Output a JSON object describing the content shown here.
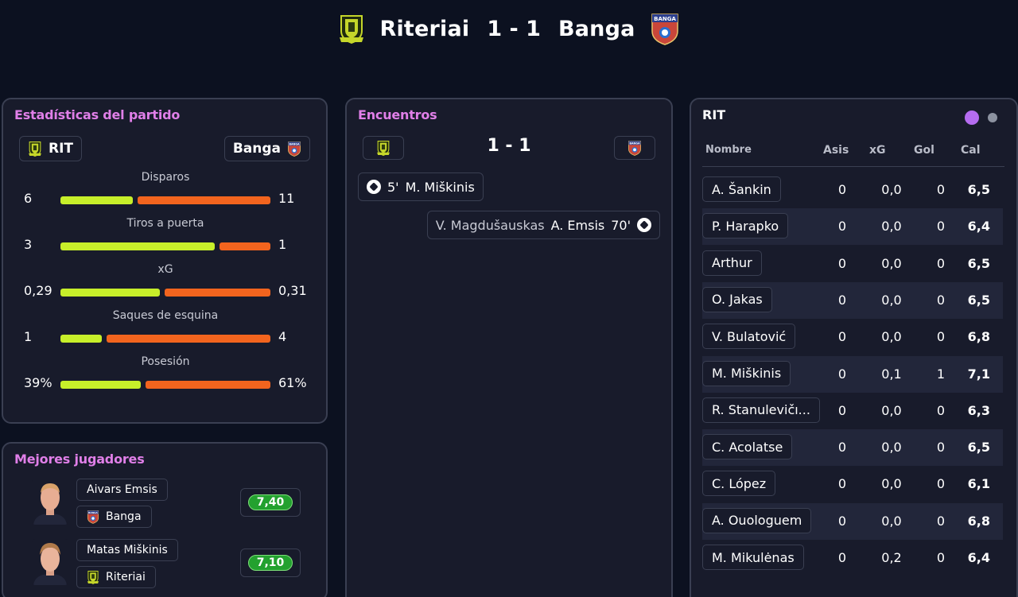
{
  "header": {
    "home_team": "Riteriai",
    "score": "1 - 1",
    "away_team": "Banga",
    "home_crest": "riteriai-crest-icon",
    "away_crest": "banga-crest-icon"
  },
  "stats": {
    "title": "Estadísticas del partido",
    "home_chip": "RIT",
    "away_chip": "Banga",
    "rows": [
      {
        "label": "Disparos",
        "home": "6",
        "away": "11",
        "home_share": 0.353
      },
      {
        "label": "Tiros a puerta",
        "home": "3",
        "away": "1",
        "home_share": 0.75
      },
      {
        "label": "xG",
        "home": "0,29",
        "away": "0,31",
        "home_share": 0.483
      },
      {
        "label": "Saques de esquina",
        "home": "1",
        "away": "4",
        "home_share": 0.2
      },
      {
        "label": "Posesión",
        "home": "39%",
        "away": "61%",
        "home_share": 0.39
      }
    ],
    "colors": {
      "home": "#c7ef2a",
      "away": "#f2641e"
    }
  },
  "best_players": {
    "title": "Mejores jugadores",
    "players": [
      {
        "name": "Aivars Emsis",
        "team": "Banga",
        "rating": "7,40"
      },
      {
        "name": "Matas Miškinis",
        "team": "Riteriai",
        "rating": "7,10"
      }
    ]
  },
  "encounters": {
    "title": "Encuentros",
    "score": "1 - 1",
    "events": [
      {
        "minute": "5'",
        "player": "M. Miškinis",
        "side": "home"
      },
      {
        "assist": "V. Magdušauskas",
        "player": "A. Emsis",
        "minute": "70'",
        "side": "away"
      }
    ]
  },
  "lineup": {
    "title": "RIT",
    "toggle_colors": [
      "#b56cf0",
      "#8c92a0"
    ],
    "columns": [
      "Nombre",
      "Asis",
      "xG",
      "Gol",
      "Cal"
    ],
    "rows": [
      {
        "name": "A. Šankin",
        "asis": "0",
        "xg": "0,0",
        "gol": "0",
        "cal": "6,5"
      },
      {
        "name": "P. Harapko",
        "asis": "0",
        "xg": "0,0",
        "gol": "0",
        "cal": "6,4"
      },
      {
        "name": "Arthur",
        "asis": "0",
        "xg": "0,0",
        "gol": "0",
        "cal": "6,5"
      },
      {
        "name": "O. Jakas",
        "asis": "0",
        "xg": "0,0",
        "gol": "0",
        "cal": "6,5"
      },
      {
        "name": "V. Bulatović",
        "asis": "0",
        "xg": "0,0",
        "gol": "0",
        "cal": "6,8"
      },
      {
        "name": "M. Miškinis",
        "asis": "0",
        "xg": "0,1",
        "gol": "1",
        "cal": "7,1"
      },
      {
        "name": "R. Stanulevičı...",
        "asis": "0",
        "xg": "0,0",
        "gol": "0",
        "cal": "6,3"
      },
      {
        "name": "C. Acolatse",
        "asis": "0",
        "xg": "0,0",
        "gol": "0",
        "cal": "6,5"
      },
      {
        "name": "C. López",
        "asis": "0",
        "xg": "0,0",
        "gol": "0",
        "cal": "6,1"
      },
      {
        "name": "A. Ouologuem",
        "asis": "0",
        "xg": "0,0",
        "gol": "0",
        "cal": "6,8"
      },
      {
        "name": "M. Mikulėnas",
        "asis": "0",
        "xg": "0,2",
        "gol": "0",
        "cal": "6,4"
      }
    ]
  }
}
